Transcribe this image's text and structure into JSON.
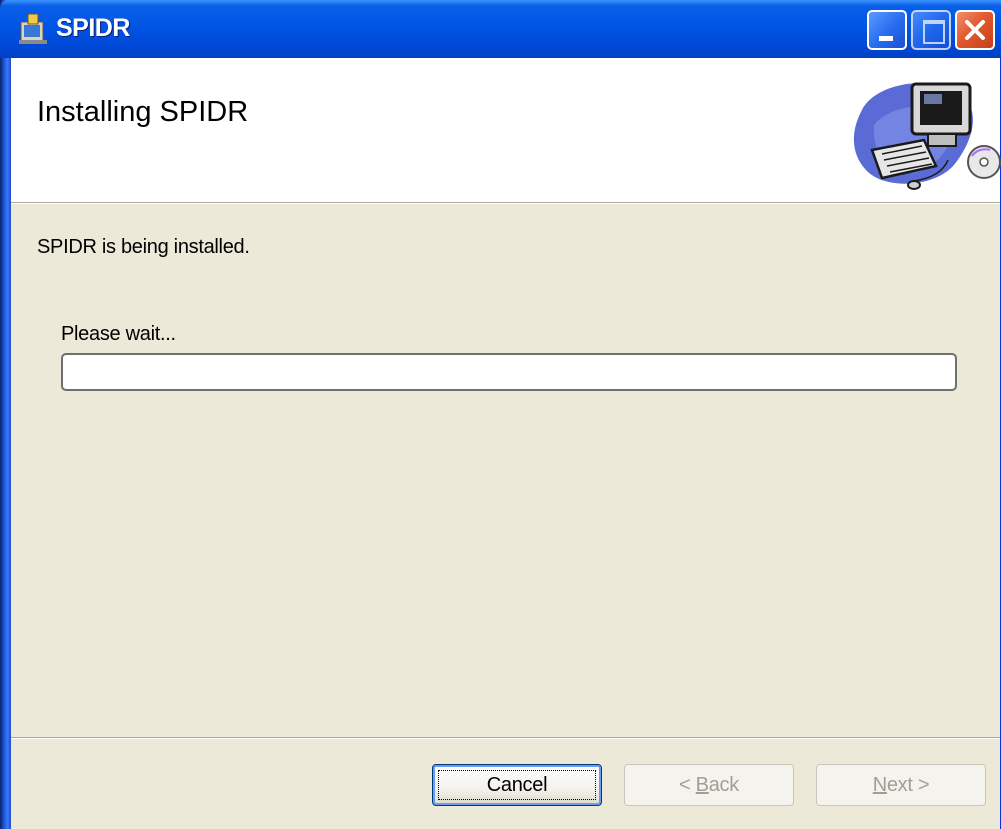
{
  "window": {
    "title": "SPIDR",
    "controls": {
      "minimize": "minimize-icon",
      "maximize": "maximize-icon",
      "close": "close-icon"
    }
  },
  "banner": {
    "title": "Installing SPIDR",
    "art": "computer-install-icon"
  },
  "body": {
    "status_text": "SPIDR is being installed.",
    "wait_label": "Please wait...",
    "progress_percent": 0
  },
  "buttons": {
    "cancel": {
      "label": "Cancel",
      "enabled": true
    },
    "back": {
      "label_prefix": "< ",
      "mnemonic": "B",
      "label_rest": "ack",
      "enabled": false
    },
    "next": {
      "mnemonic": "N",
      "label_rest": "ext",
      "label_suffix": " >",
      "enabled": false
    }
  },
  "colors": {
    "title_bar": "#0055e5",
    "dialog_background": "#ece9d8",
    "close_button": "#e25a2e",
    "disabled_text": "#a19f92"
  }
}
